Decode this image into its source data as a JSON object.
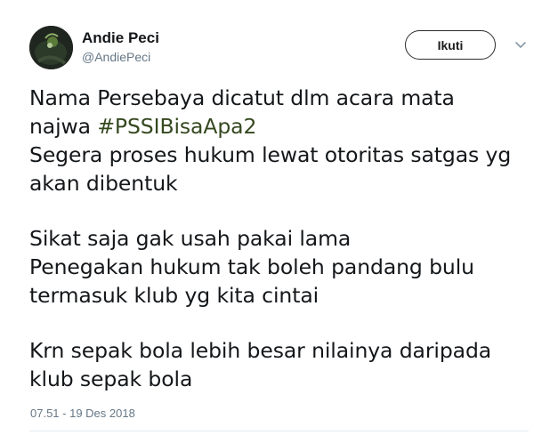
{
  "user": {
    "name": "Andie Peci",
    "handle": "@AndiePeci"
  },
  "follow_button": {
    "label": "Ikuti"
  },
  "tweet": {
    "lines": [
      "Nama Persebaya dicatut dlm acara mata",
      "Segera proses hukum lewat otoritas satgas yg",
      "akan dibentuk",
      "Sikat saja gak usah pakai lama",
      "Penegakan hukum tak boleh pandang bulu",
      "termasuk klub yg kita cintai",
      "Krn sepak bola lebih besar nilainya daripada",
      "klub sepak bola"
    ],
    "line2_prefix": "najwa ",
    "hashtag": "#PSSIBisaApa2",
    "hashtag_color": "#35481f"
  },
  "timestamp": "07.51 - 19 Des 2018",
  "icons": {
    "menu": "chevron-down-icon",
    "avatar": "avatar"
  }
}
